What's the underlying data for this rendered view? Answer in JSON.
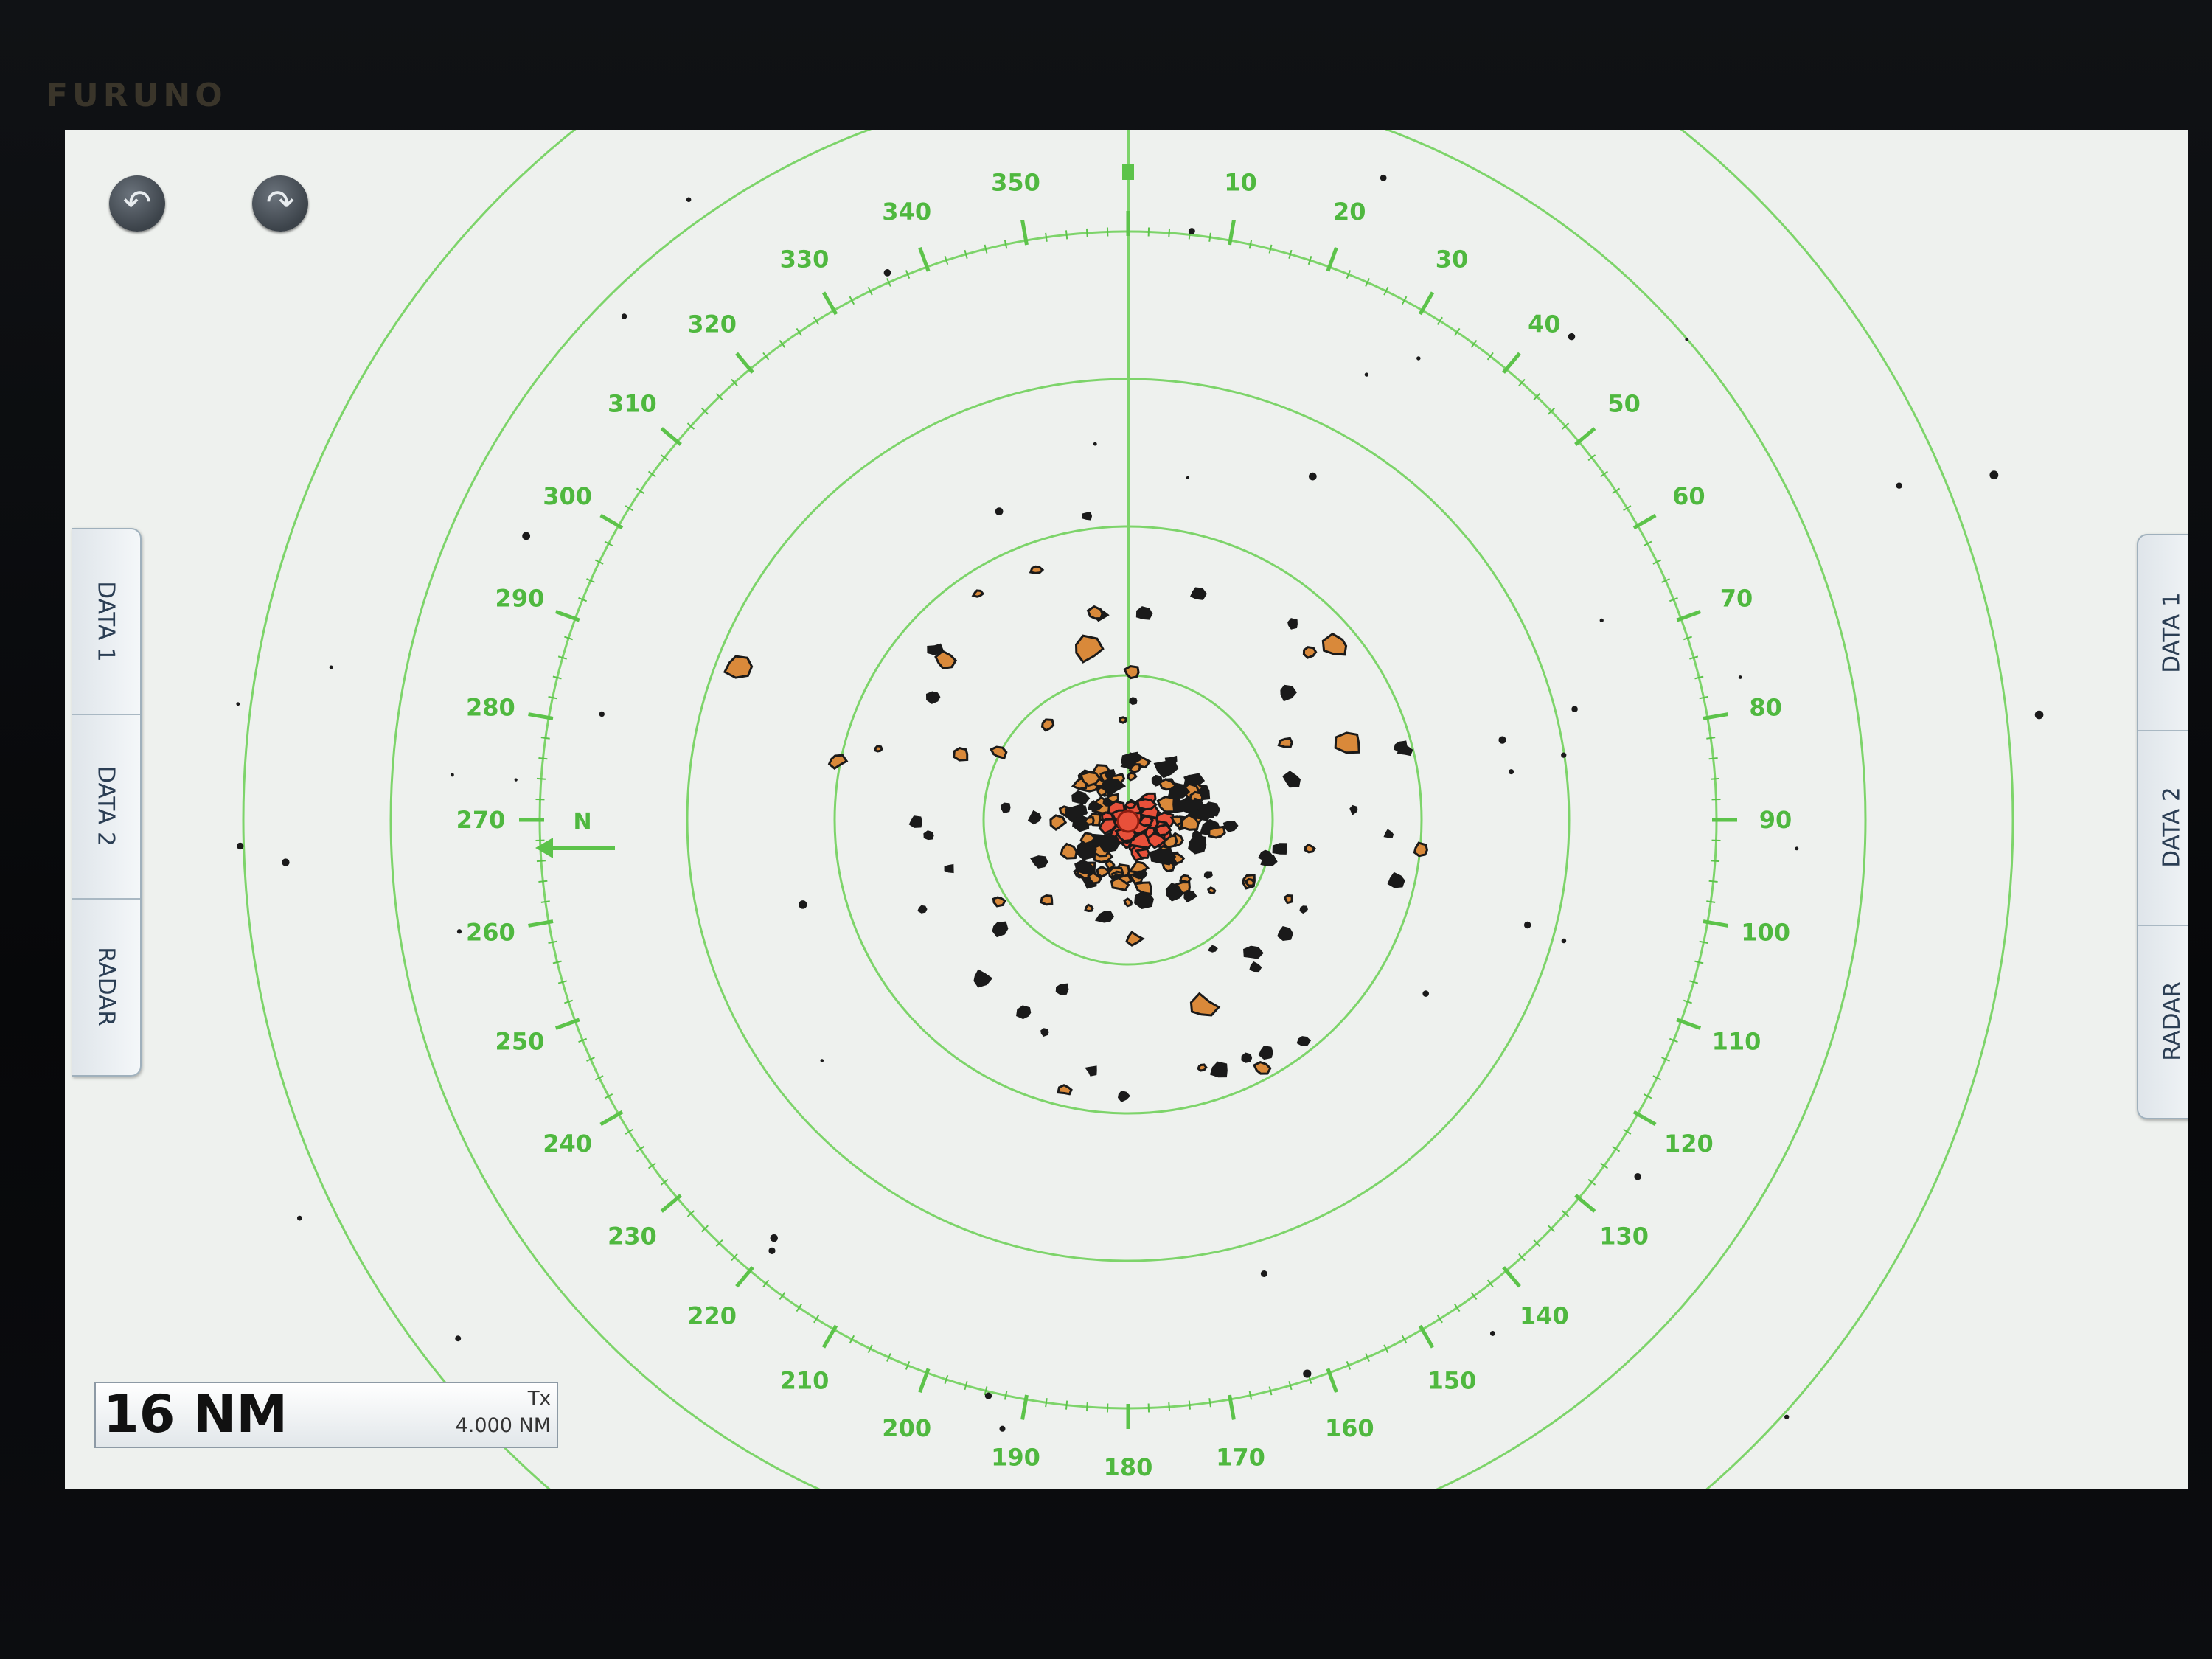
{
  "bezel": {
    "brand": "FURUNO"
  },
  "toolbar": {
    "undo_icon": "undo-icon",
    "redo_icon": "redo-icon"
  },
  "left_panel": {
    "tabs": [
      "DATA 1",
      "DATA 2",
      "RADAR"
    ]
  },
  "right_panel": {
    "tabs": [
      "DATA 1",
      "DATA 2",
      "RADAR"
    ]
  },
  "range": {
    "value": "16 NM",
    "tx_label": "Tx",
    "ring_interval": "4.000 NM"
  },
  "bearing_scale": {
    "labels": [
      "10",
      "20",
      "30",
      "40",
      "50",
      "60",
      "70",
      "80",
      "90",
      "100",
      "110",
      "120",
      "130",
      "140",
      "150",
      "160",
      "170",
      "180",
      "190",
      "200",
      "210",
      "220",
      "230",
      "240",
      "250",
      "260",
      "270",
      "280",
      "290",
      "300",
      "310",
      "320",
      "330",
      "340",
      "350"
    ],
    "north_marker": "N"
  },
  "colors": {
    "screen_bg": "#eef1ee",
    "rings": "#7dd46a",
    "scale": "#5cc34a",
    "labels": "#4fb83f",
    "echo_core": "#e8503a",
    "echo_mid": "#d9893a",
    "echo_outline": "#1a1a1a"
  }
}
